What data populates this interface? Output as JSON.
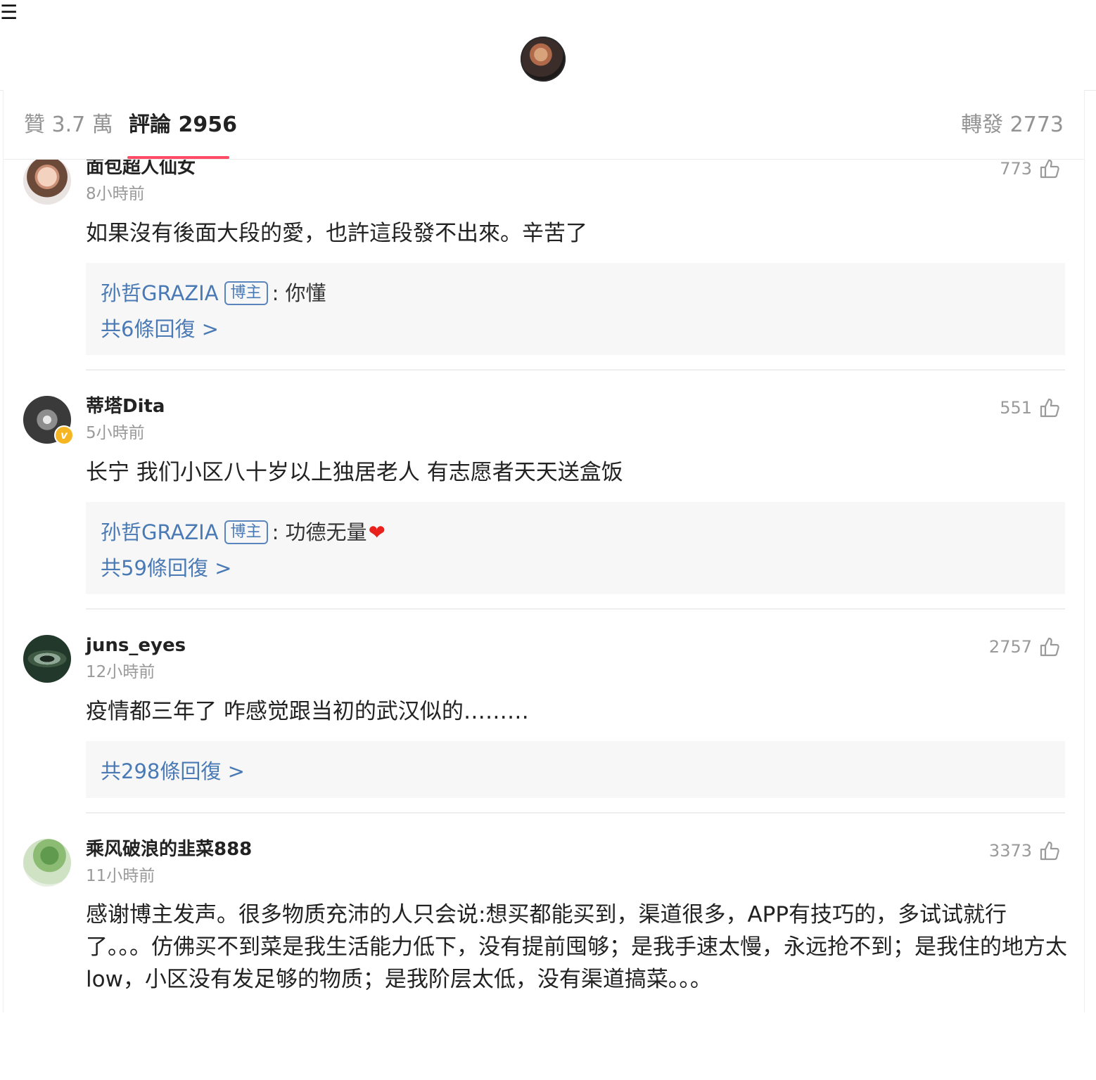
{
  "menu_icon": "☰",
  "header": {
    "avatar_icon": "profile-avatar"
  },
  "tabs": {
    "likes": "贊 3.7 萬",
    "comments": "評論 2956",
    "reposts": "轉發 2773"
  },
  "colors": {
    "accent": "#ff4b66",
    "link": "#4a7ab5",
    "muted": "#9a9a9a",
    "verified": "#f6b623"
  },
  "comments": [
    {
      "username": "面包超人仙女",
      "time": "8小時前",
      "likes": "773",
      "text": "如果沒有後面大段的愛，也許這段發不出來。辛苦了",
      "reply": {
        "author": "孙哲GRAZIA",
        "badge": "博主",
        "text": ": 你懂"
      },
      "reply_count": "共6條回復 >"
    },
    {
      "username": "蒂塔Dita",
      "time": "5小時前",
      "likes": "551",
      "verified": "v",
      "text": "长宁 我们小区八十岁以上独居老人 有志愿者天天送盒饭",
      "reply": {
        "author": "孙哲GRAZIA",
        "badge": "博主",
        "text": ": 功德无量",
        "emoji": "❤"
      },
      "reply_count": "共59條回復 >"
    },
    {
      "username": "juns_eyes",
      "time": "12小時前",
      "likes": "2757",
      "text": "疫情都三年了  咋感觉跟当初的武汉似的………",
      "reply_count": "共298條回復 >"
    },
    {
      "username": "乘风破浪的韭菜888",
      "time": "11小時前",
      "likes": "3373",
      "text": "感谢博主发声。很多物质充沛的人只会说:想买都能买到，渠道很多，APP有技巧的，多试试就行了。。。仿佛买不到菜是我生活能力低下，没有提前囤够；是我手速太慢，永远抢不到；是我住的地方太low，小区没有发足够的物质；是我阶层太低，没有渠道搞菜。。。"
    }
  ]
}
